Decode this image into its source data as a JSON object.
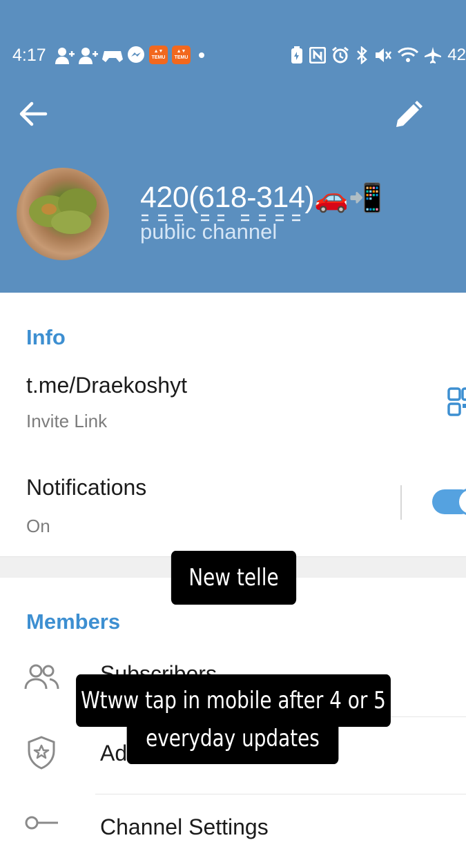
{
  "status_bar": {
    "time": "4:17",
    "battery": "42",
    "left_icons": [
      "person-add-icon",
      "person-add-icon",
      "controller-icon",
      "messenger-icon",
      "temu-icon",
      "temu-icon",
      "dot-icon"
    ],
    "right_icons": [
      "battery-saver-icon",
      "nfc-icon",
      "alarm-icon",
      "bluetooth-icon",
      "mute-icon",
      "wifi-icon",
      "airplane-icon"
    ],
    "temu_label": "TEMU"
  },
  "header": {
    "title": "420(618-314)",
    "title_emoji": "🚗📲",
    "subtitle": "public channel",
    "background": "#5b8fbf"
  },
  "info": {
    "section_label": "Info",
    "link": "t.me/Draekoshyt",
    "link_caption": "Invite Link",
    "notifications_label": "Notifications",
    "notifications_value": "On"
  },
  "members": {
    "section_label": "Members",
    "subscribers_label": "Subscribers",
    "administrators_label": "Administrators",
    "settings_label": "Channel Settings"
  },
  "captions": {
    "top": "New telle",
    "bottom_line1": "Wtww tap in mobile after 4 or 5",
    "bottom_line2": "everyday updates"
  },
  "colors": {
    "accent": "#3d8fd1",
    "toggle": "#55a2e0"
  }
}
